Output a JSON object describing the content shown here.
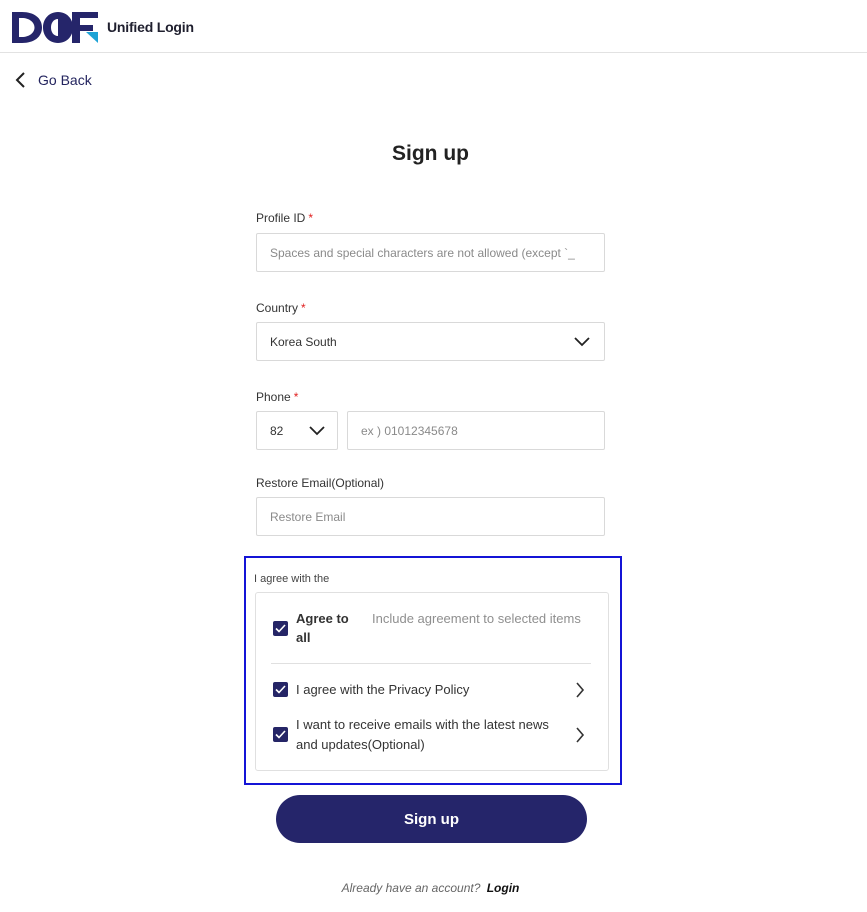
{
  "header": {
    "logo_text": "DOF",
    "title": "Unified Login"
  },
  "nav": {
    "go_back_label": "Go Back"
  },
  "page_title": "Sign up",
  "form": {
    "profile_id": {
      "label": "Profile ID",
      "required_mark": "*",
      "value": "",
      "placeholder": "Spaces and special characters are not allowed (except `_"
    },
    "country": {
      "label": "Country",
      "required_mark": "*",
      "selected": "Korea South"
    },
    "phone": {
      "label": "Phone",
      "required_mark": "*",
      "country_code": "82",
      "value": "",
      "placeholder": "ex ) 01012345678"
    },
    "restore_email": {
      "label": "Restore Email(Optional)",
      "value": "",
      "placeholder": "Restore Email"
    }
  },
  "agreement": {
    "heading": "I agree with the",
    "agree_all": {
      "label": "Agree to all",
      "description": "Include agreement to selected items",
      "checked": true
    },
    "items": [
      {
        "label": "I agree with the Privacy Policy",
        "checked": true
      },
      {
        "label": "I want to receive emails with the latest news and updates(Optional)",
        "checked": true
      }
    ]
  },
  "submit": {
    "label": "Sign up"
  },
  "footer": {
    "prompt": "Already have an account?",
    "login_label": "Login"
  },
  "colors": {
    "brand_navy": "#25256a",
    "logo_accent": "#1fa3d6",
    "required_red": "#e02020",
    "highlight_border": "#1414d6"
  }
}
